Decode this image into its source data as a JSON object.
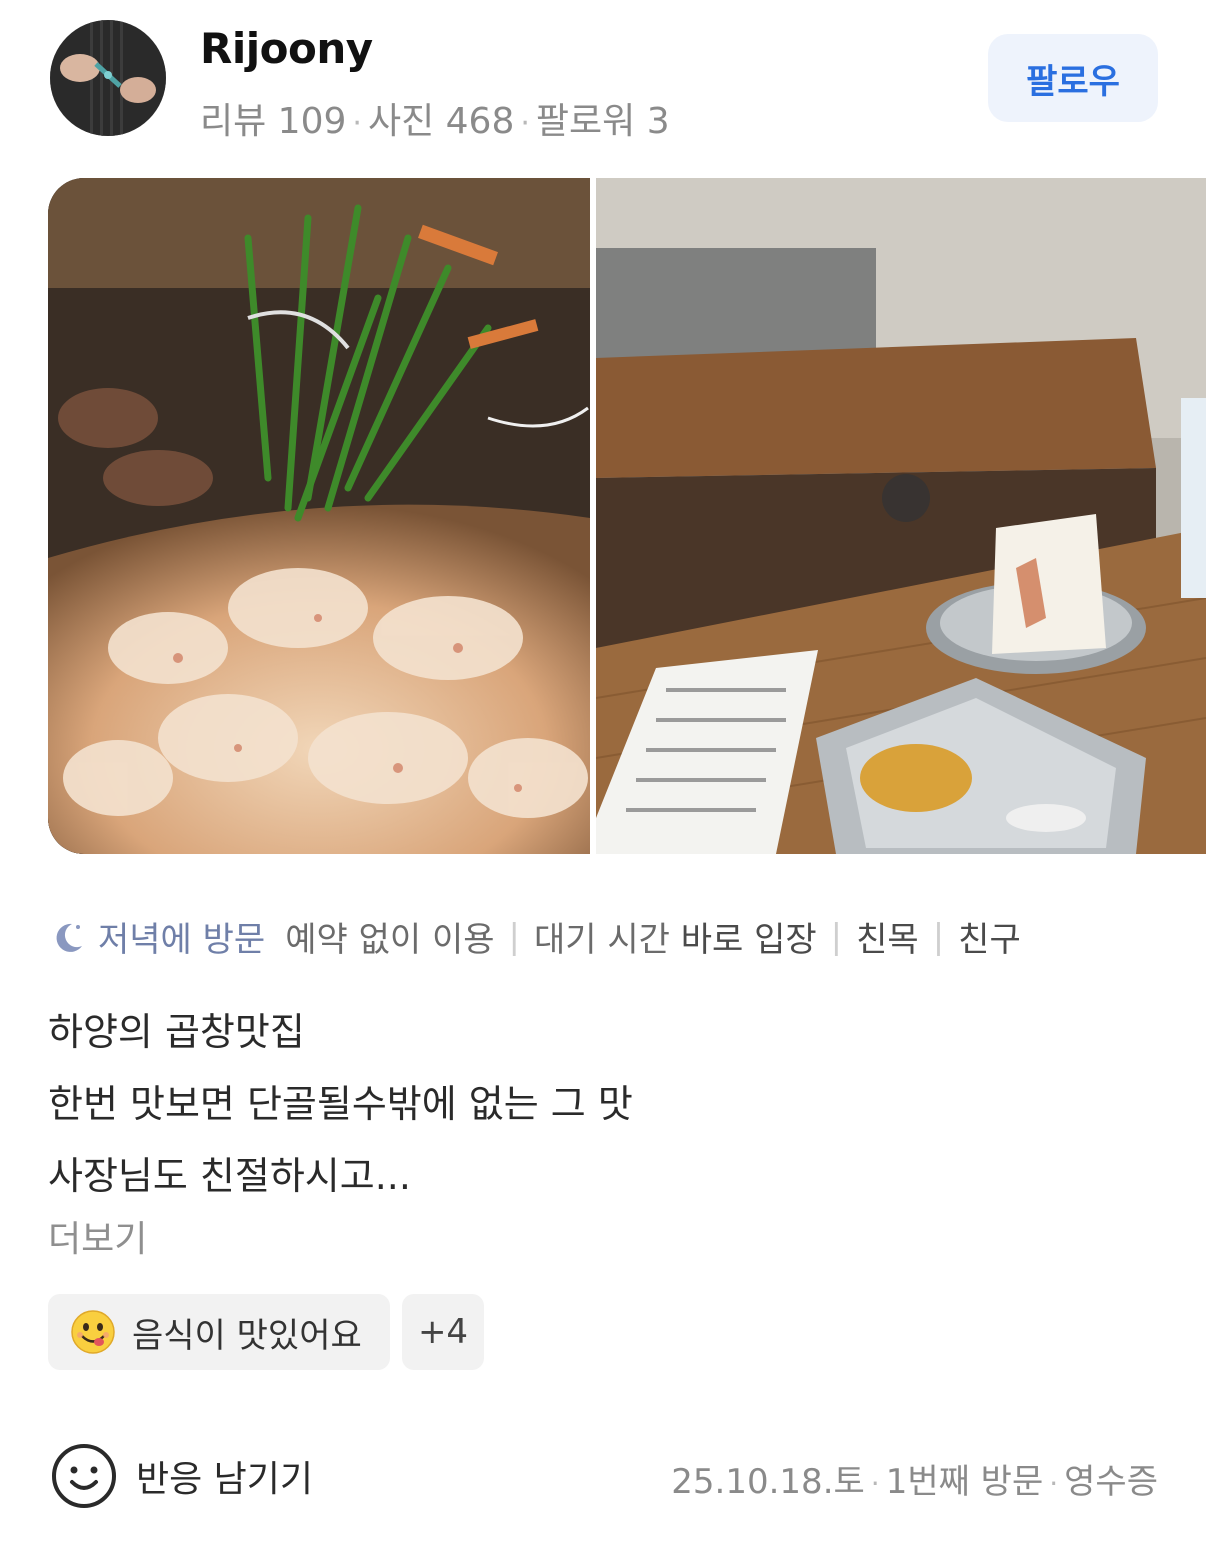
{
  "header": {
    "username": "Rijoony",
    "stats": {
      "reviews": "리뷰 109",
      "photos": "사진 468",
      "followers": "팔로워 3"
    },
    "follow_label": "팔로우"
  },
  "photos": [
    {
      "name": "grilled-gopchang-photo"
    },
    {
      "name": "table-receipt-photo"
    }
  ],
  "visit": {
    "time": "저녁에 방문",
    "reservation": "예약 없이 이용",
    "wait_label": "대기 시간",
    "wait_value": "바로 입장",
    "purpose": "친목",
    "companion": "친구"
  },
  "review": {
    "lines": [
      "하양의 곱창맛집",
      "한번 맛보면 단골될수밖에 없는 그 맛",
      "사장님도 친절하시고..."
    ],
    "more_label": "더보기"
  },
  "tags": {
    "main": "음식이 맛있어요",
    "more": "+4"
  },
  "footer": {
    "react_label": "반응 남기기",
    "date": "25.10.18.토",
    "visit_count": "1번째 방문",
    "verification": "영수증"
  },
  "colors": {
    "accent": "#2a6fe0",
    "follow_bg": "#eef3fc",
    "visit_time": "#6f7fa8",
    "muted": "#8a8a8a"
  }
}
